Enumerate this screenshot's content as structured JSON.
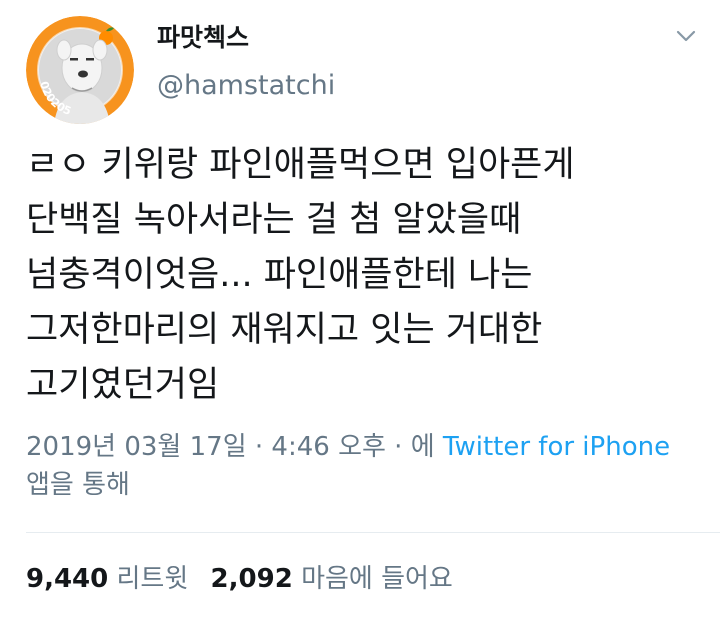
{
  "author": {
    "display_name": "파맛첵스",
    "handle": "@hamstatchi",
    "avatar_badge": "020205",
    "avatar_icon": "costume-character-avatar",
    "accent_color": "#f7931e"
  },
  "menu": {
    "icon": "chevron-down-icon"
  },
  "tweet": {
    "lines": [
      "ㄹㅇ 키위랑 파인애플먹으면 입아픈게",
      "단백질 녹아서라는 걸 첨 알았을때",
      "넘충격이엇음... 파인애플한테 나는",
      "그저한마리의 재워지고 잇는 거대한",
      "고기였던거임"
    ]
  },
  "meta": {
    "timestamp": "2019년 03월 17일 · 4:46 오후 · 에",
    "source": "Twitter for iPhone",
    "via": "앱을 통해"
  },
  "stats": {
    "retweets": {
      "count": "9,440",
      "label": "리트윗"
    },
    "likes": {
      "count": "2,092",
      "label": "마음에 들어요"
    }
  },
  "colors": {
    "text": "#14171a",
    "secondary": "#657786",
    "link": "#1da1f2",
    "divider": "#e6ecf0"
  }
}
